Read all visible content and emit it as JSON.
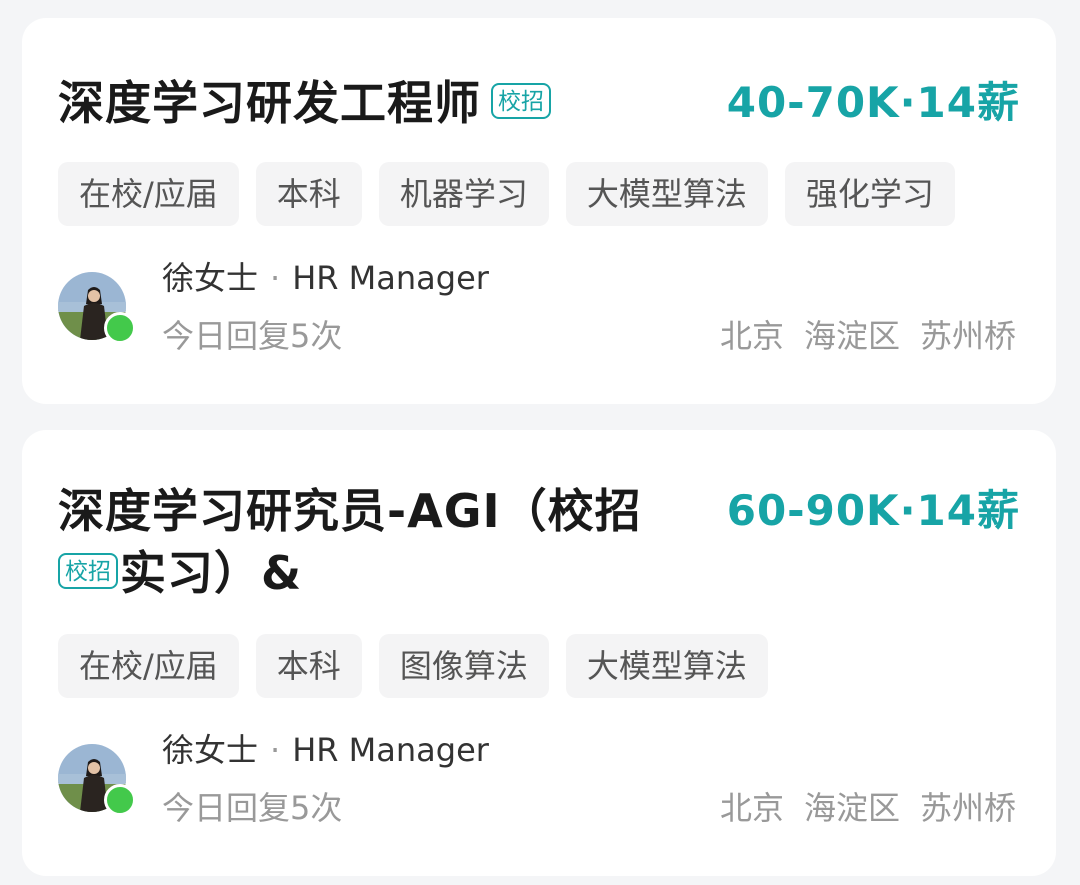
{
  "jobs": [
    {
      "title": "深度学习研发工程师",
      "title_line2": "",
      "badge": "校招",
      "salary": "40-70K·14薪",
      "tags": [
        "在校/应届",
        "本科",
        "机器学习",
        "大模型算法",
        "强化学习"
      ],
      "hr": {
        "name": "徐女士",
        "separator": "·",
        "role": "HR Manager",
        "reply": "今日回复5次",
        "online": true
      },
      "location": [
        "北京",
        "海淀区",
        "苏州桥"
      ]
    },
    {
      "title": "深度学习研究员-AGI（校招",
      "title_line2": "实习）&",
      "badge": "校招",
      "salary": "60-90K·14薪",
      "tags": [
        "在校/应届",
        "本科",
        "图像算法",
        "大模型算法"
      ],
      "hr": {
        "name": "徐女士",
        "separator": "·",
        "role": "HR Manager",
        "reply": "今日回复5次",
        "online": true
      },
      "location": [
        "北京",
        "海淀区",
        "苏州桥"
      ]
    }
  ],
  "colors": {
    "accent": "#17a4a6",
    "online": "#43c94b",
    "tag_bg": "#f4f4f5",
    "page_bg": "#f4f5f7"
  }
}
